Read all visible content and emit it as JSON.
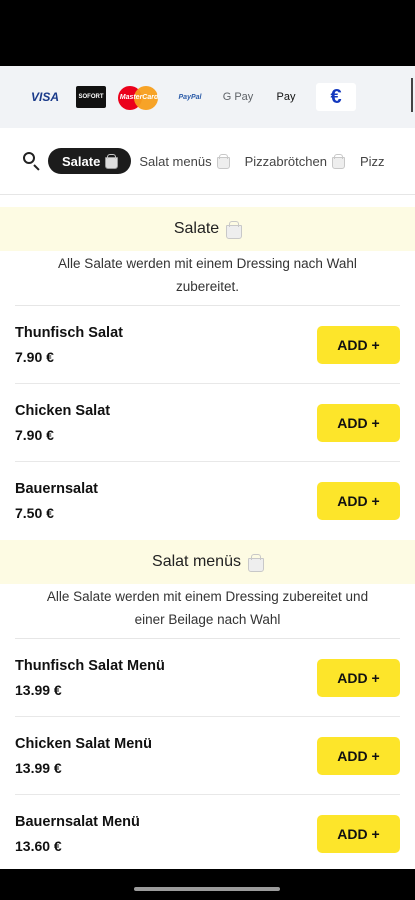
{
  "payments": {
    "visa": "VISA",
    "sofort": "SOFORT",
    "mastercard": "MasterCard",
    "paypal": "PayPal",
    "gpay": "G Pay",
    "applepay": "Pay",
    "euro": "€"
  },
  "categories": [
    {
      "label": "Salate",
      "active": true
    },
    {
      "label": "Salat menüs",
      "active": false
    },
    {
      "label": "Pizzabrötchen",
      "active": false
    },
    {
      "label": "Pizz",
      "active": false
    }
  ],
  "sections": [
    {
      "title": "Salate",
      "description": "Alle Salate werden mit einem Dressing nach Wahl zubereitet.",
      "items": [
        {
          "name": "Thunfisch Salat",
          "price": "7.90 €",
          "button": "ADD +"
        },
        {
          "name": "Chicken Salat",
          "price": "7.90 €",
          "button": "ADD +"
        },
        {
          "name": "Bauernsalat",
          "price": "7.50 €",
          "button": "ADD +"
        }
      ]
    },
    {
      "title": "Salat menüs",
      "description": "Alle Salate werden mit einem Dressing zubereitet und einer Beilage nach Wahl",
      "items": [
        {
          "name": "Thunfisch Salat Menü",
          "price": "13.99 €",
          "button": "ADD +"
        },
        {
          "name": "Chicken Salat Menü",
          "price": "13.99 €",
          "button": "ADD +"
        },
        {
          "name": "Bauernsalat Menü",
          "price": "13.60 €",
          "button": "ADD +"
        }
      ]
    }
  ],
  "colors": {
    "accent": "#fde52a",
    "section_bg": "#fdfbe3",
    "chip_active": "#1c1c1c"
  },
  "icons": {
    "search": "search-icon",
    "category": "takeout-box-icon"
  }
}
